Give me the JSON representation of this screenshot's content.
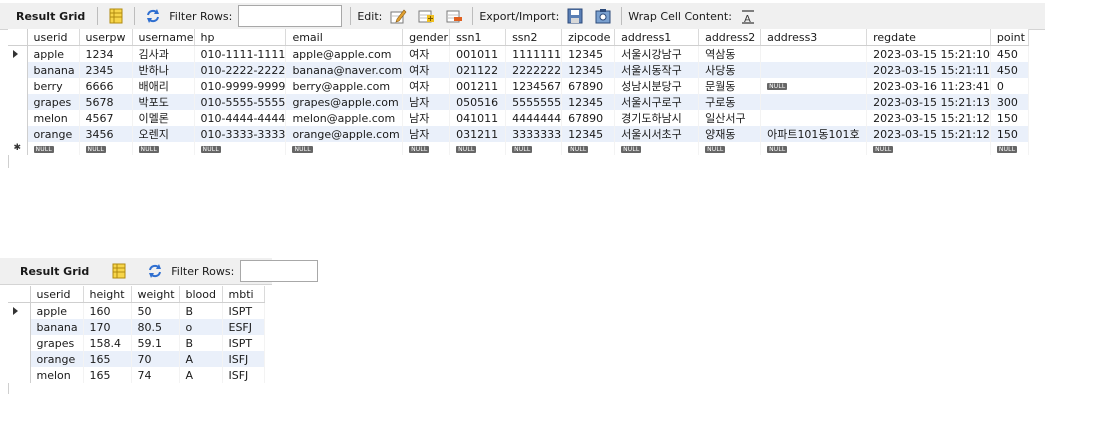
{
  "top": {
    "toolbar": {
      "title": "Result Grid",
      "filter_label": "Filter Rows:",
      "filter_value": "",
      "edit_label": "Edit:",
      "export_label": "Export/Import:",
      "wrap_label": "Wrap Cell Content:",
      "icons": [
        "grid-form-icon",
        "refresh-icon",
        "edit-row-icon",
        "add-row-icon",
        "delete-row-icon",
        "export-icon",
        "import-icon",
        "wrap-text-icon"
      ]
    },
    "null_text": "NULL",
    "columns": [
      "userid",
      "userpw",
      "username",
      "hp",
      "email",
      "gender",
      "ssn1",
      "ssn2",
      "zipcode",
      "address1",
      "address2",
      "address3",
      "regdate",
      "point"
    ],
    "rows": [
      [
        "apple",
        "1234",
        "김사과",
        "010-1111-1111",
        "apple@apple.com",
        "여자",
        "001011",
        "1111111",
        "12345",
        "서울시강남구",
        "역삼동",
        "",
        "2023-03-15 15:21:10",
        "450"
      ],
      [
        "banana",
        "2345",
        "반하나",
        "010-2222-2222",
        "banana@naver.com",
        "여자",
        "021122",
        "2222222",
        "12345",
        "서울시동작구",
        "사당동",
        "",
        "2023-03-15 15:21:11",
        "450"
      ],
      [
        "berry",
        "6666",
        "배애리",
        "010-9999-9999",
        "berry@apple.com",
        "여자",
        "001211",
        "1234567",
        "67890",
        "성남시분당구",
        "문월동",
        null,
        "2023-03-16 11:23:41",
        "0"
      ],
      [
        "grapes",
        "5678",
        "박포도",
        "010-5555-5555",
        "grapes@apple.com",
        "남자",
        "050516",
        "5555555",
        "12345",
        "서울시구로구",
        "구로동",
        "",
        "2023-03-15 15:21:13",
        "300"
      ],
      [
        "melon",
        "4567",
        "이멜론",
        "010-4444-4444",
        "melon@apple.com",
        "남자",
        "041011",
        "4444444",
        "67890",
        "경기도하남시",
        "일산서구",
        "",
        "2023-03-15 15:21:12",
        "150"
      ],
      [
        "orange",
        "3456",
        "오렌지",
        "010-3333-3333",
        "orange@apple.com",
        "남자",
        "031211",
        "3333333",
        "12345",
        "서울시서초구",
        "양재동",
        "아파트101동101호",
        "2023-03-15 15:21:12",
        "150"
      ]
    ]
  },
  "bottom": {
    "toolbar": {
      "title": "Result Grid",
      "filter_label": "Filter Rows:",
      "filter_value": "",
      "icons": [
        "grid-form-icon",
        "refresh-icon"
      ]
    },
    "columns": [
      "userid",
      "height",
      "weight",
      "blood",
      "mbti"
    ],
    "rows": [
      [
        "apple",
        "160",
        "50",
        "B",
        "ISPT"
      ],
      [
        "banana",
        "170",
        "80.5",
        "o",
        "ESFJ"
      ],
      [
        "grapes",
        "158.4",
        "59.1",
        "B",
        "ISPT"
      ],
      [
        "orange",
        "165",
        "70",
        "A",
        "ISFJ"
      ],
      [
        "melon",
        "165",
        "74",
        "A",
        "ISFJ"
      ]
    ]
  },
  "colors": {
    "alt_row": "#eaf0fa",
    "toolbar_bg": "#f0f0f0",
    "null_badge": "#666666",
    "icon_blue": "#2f6fd0"
  }
}
